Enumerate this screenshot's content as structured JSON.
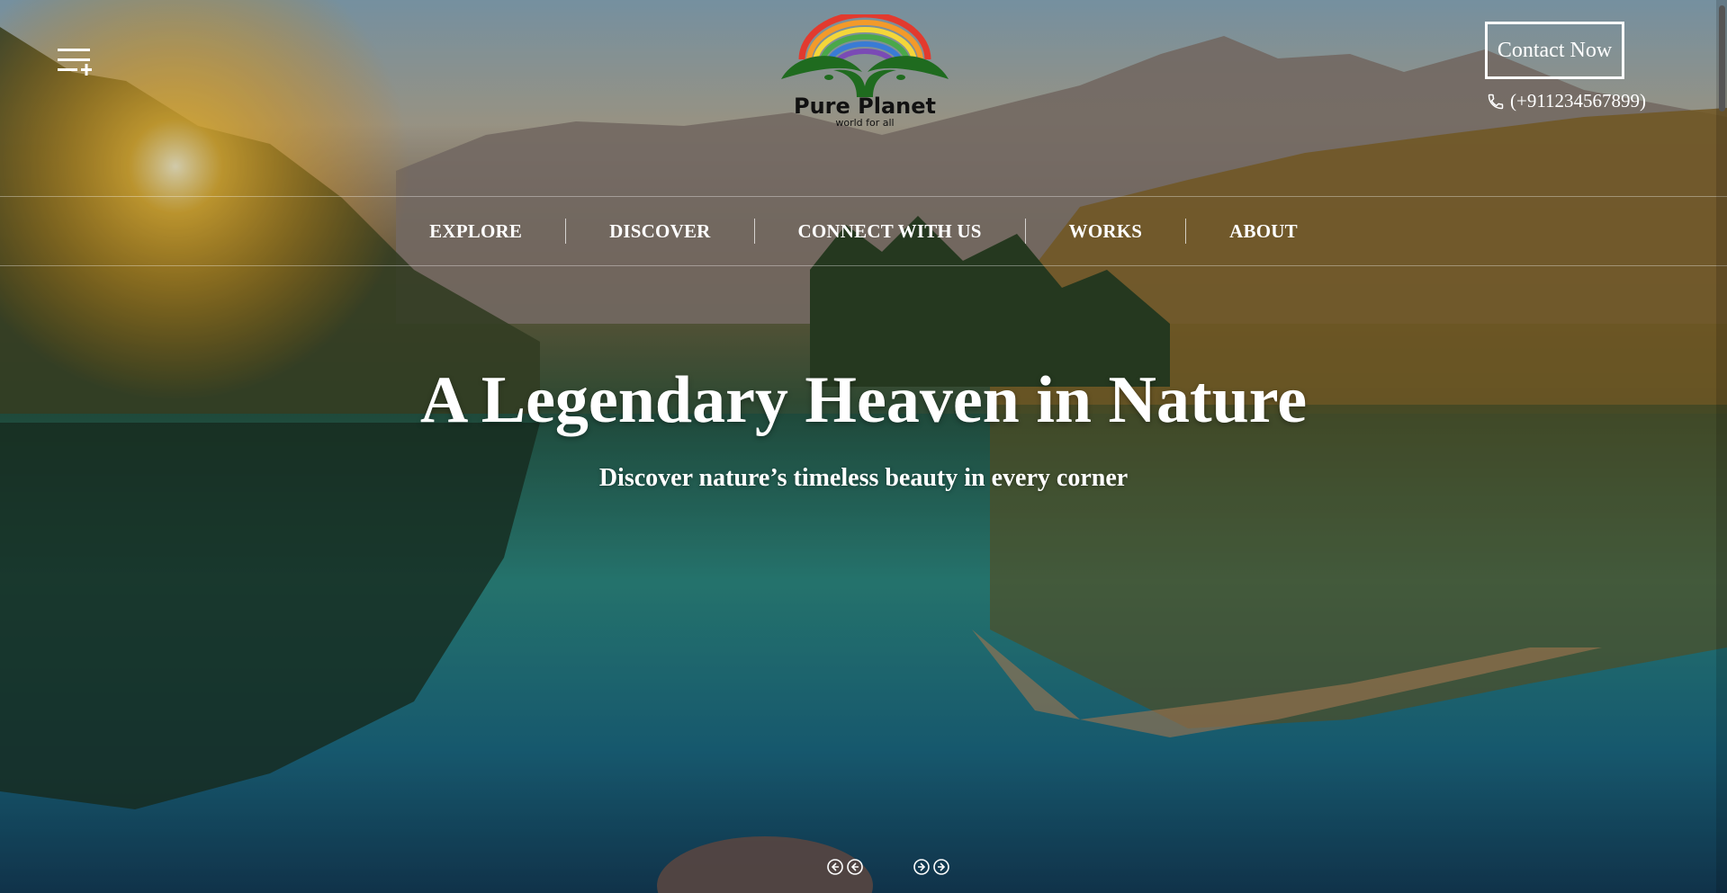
{
  "brand": {
    "name": "Pure Planet",
    "tagline": "world for all"
  },
  "header": {
    "contact_label": "Contact Now",
    "phone": "(+911234567899)"
  },
  "nav": {
    "items": [
      {
        "label": "EXPLORE"
      },
      {
        "label": "DISCOVER"
      },
      {
        "label": "CONNECT WITH US"
      },
      {
        "label": "WORKS"
      },
      {
        "label": "ABOUT"
      }
    ]
  },
  "hero": {
    "headline": "A Legendary Heaven in Nature",
    "subheadline": "Discover nature’s timeless beauty in every corner"
  },
  "icons": {
    "menu": "menu-plus-icon",
    "phone": "phone-icon",
    "prev": "double-arrow-left-icon",
    "next": "double-arrow-right-icon"
  },
  "colors": {
    "text": "#ffffff",
    "logo_green": "#1f6b1f"
  }
}
